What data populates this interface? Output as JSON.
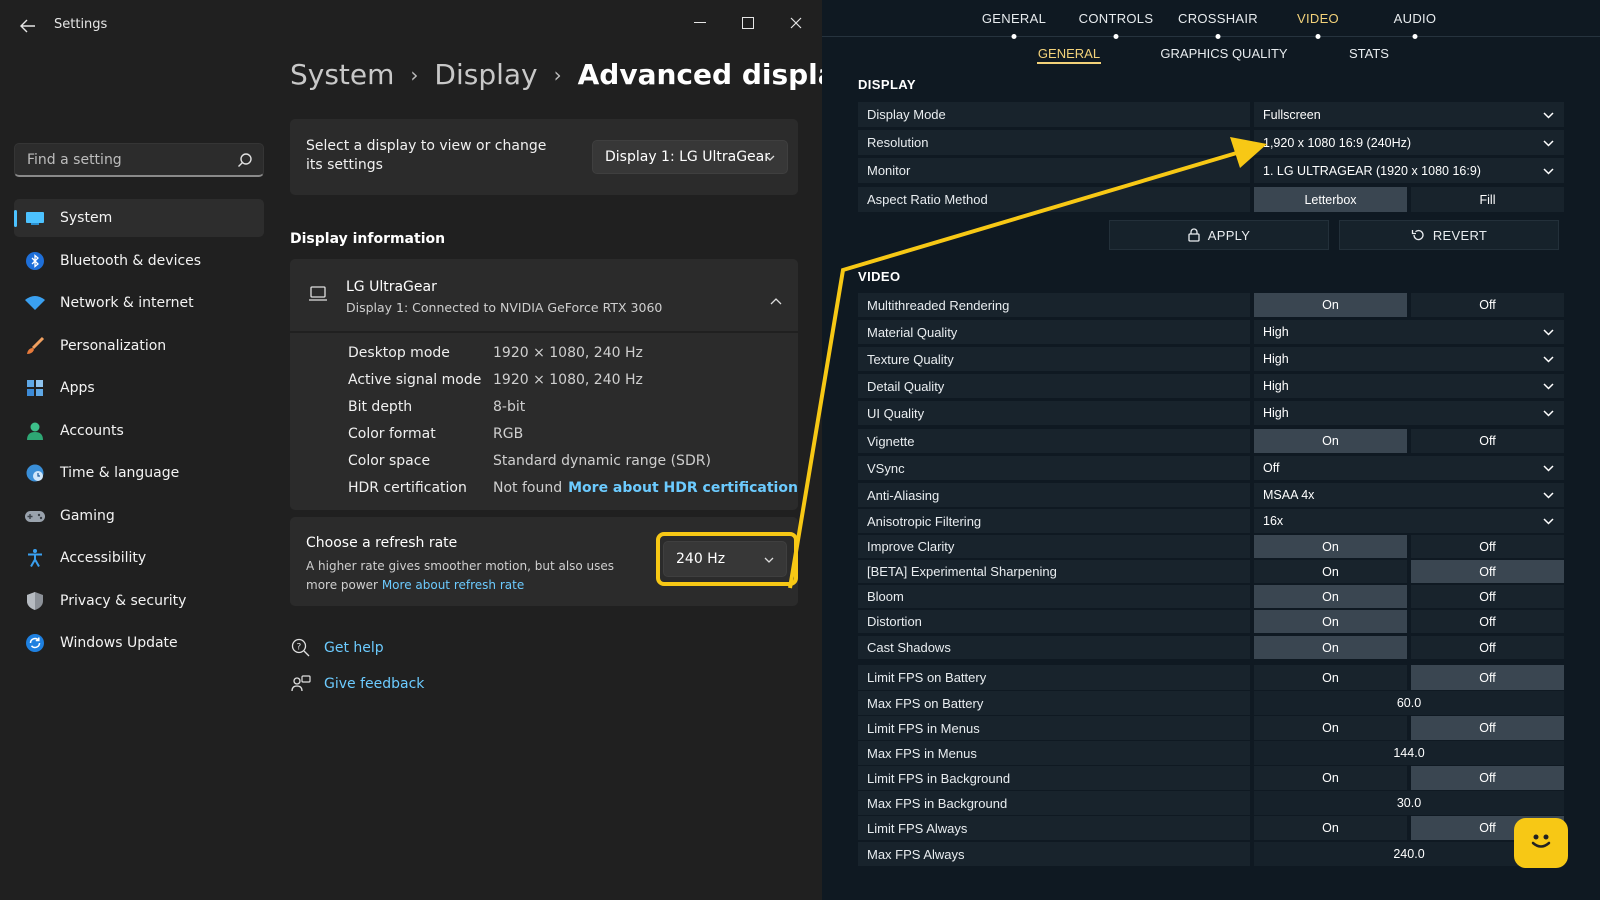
{
  "settings": {
    "app_title": "Settings",
    "search": {
      "placeholder": "Find a setting"
    },
    "nav": [
      {
        "label": "System",
        "icon": "monitor-icon",
        "active": true
      },
      {
        "label": "Bluetooth & devices",
        "icon": "bluetooth-icon"
      },
      {
        "label": "Network & internet",
        "icon": "wifi-icon"
      },
      {
        "label": "Personalization",
        "icon": "paintbrush-icon"
      },
      {
        "label": "Apps",
        "icon": "apps-icon"
      },
      {
        "label": "Accounts",
        "icon": "person-icon"
      },
      {
        "label": "Time & language",
        "icon": "globe-clock-icon"
      },
      {
        "label": "Gaming",
        "icon": "gamepad-icon"
      },
      {
        "label": "Accessibility",
        "icon": "accessibility-icon"
      },
      {
        "label": "Privacy & security",
        "icon": "shield-icon"
      },
      {
        "label": "Windows Update",
        "icon": "update-icon"
      }
    ],
    "breadcrumb": [
      "System",
      "Display",
      "Advanced display"
    ],
    "select_display": {
      "text": "Select a display to view or change its settings",
      "value": "Display 1: LG UltraGear"
    },
    "display_info": {
      "title": "Display information",
      "monitor_name": "LG UltraGear",
      "monitor_sub": "Display 1: Connected to NVIDIA GeForce RTX 3060",
      "rows": [
        {
          "label": "Desktop mode",
          "value": "1920 × 1080, 240 Hz"
        },
        {
          "label": "Active signal mode",
          "value": "1920 × 1080, 240 Hz"
        },
        {
          "label": "Bit depth",
          "value": "8-bit"
        },
        {
          "label": "Color format",
          "value": "RGB"
        },
        {
          "label": "Color space",
          "value": "Standard dynamic range (SDR)"
        },
        {
          "label": "HDR certification",
          "value": "Not found",
          "link": "More about HDR certification"
        }
      ]
    },
    "refresh": {
      "title": "Choose a refresh rate",
      "desc": "A higher rate gives smoother motion, but also uses more power",
      "link": "More about refresh rate",
      "value": "240 Hz"
    },
    "help": {
      "get_help": "Get help",
      "feedback": "Give feedback"
    }
  },
  "game": {
    "tabs": [
      "GENERAL",
      "CONTROLS",
      "CROSSHAIR",
      "VIDEO",
      "AUDIO"
    ],
    "active_tab": "VIDEO",
    "subtabs": [
      "GENERAL",
      "GRAPHICS QUALITY",
      "STATS"
    ],
    "active_subtab": "GENERAL",
    "display_section": "DISPLAY",
    "display_rows": [
      {
        "label": "Display Mode",
        "value": "Fullscreen"
      },
      {
        "label": "Resolution",
        "value": "1,920 x 1080 16:9 (240Hz)"
      },
      {
        "label": "Monitor",
        "value": "1. LG ULTRAGEAR (1920 x 1080 16:9)"
      }
    ],
    "aspect": {
      "label": "Aspect Ratio Method",
      "opt1": "Letterbox",
      "opt2": "Fill",
      "selected": "Letterbox"
    },
    "apply_label": "APPLY",
    "revert_label": "REVERT",
    "video_section": "VIDEO",
    "video_rows": [
      {
        "label": "Multithreaded Rendering",
        "type": "toggle",
        "selected": "On"
      },
      {
        "label": "Material Quality",
        "type": "dropdown",
        "value": "High"
      },
      {
        "label": "Texture Quality",
        "type": "dropdown",
        "value": "High"
      },
      {
        "label": "Detail Quality",
        "type": "dropdown",
        "value": "High"
      },
      {
        "label": "UI Quality",
        "type": "dropdown",
        "value": "High"
      },
      {
        "label": "Vignette",
        "type": "toggle",
        "selected": "On"
      },
      {
        "label": "VSync",
        "type": "dropdown",
        "value": "Off"
      },
      {
        "label": "Anti-Aliasing",
        "type": "dropdown",
        "value": "MSAA 4x"
      },
      {
        "label": "Anisotropic Filtering",
        "type": "dropdown",
        "value": "16x"
      },
      {
        "label": "Improve Clarity",
        "type": "toggle",
        "selected": "On"
      },
      {
        "label": "[BETA] Experimental Sharpening",
        "type": "toggle",
        "selected": "Off"
      },
      {
        "label": "Bloom",
        "type": "toggle",
        "selected": "On"
      },
      {
        "label": "Distortion",
        "type": "toggle",
        "selected": "On"
      },
      {
        "label": "Cast Shadows",
        "type": "toggle",
        "selected": "On"
      },
      {
        "label": "Limit FPS on Battery",
        "type": "toggle",
        "selected": "Off"
      },
      {
        "label": "Max FPS on Battery",
        "type": "number",
        "value": "60.0"
      },
      {
        "label": "Limit FPS in Menus",
        "type": "toggle",
        "selected": "Off"
      },
      {
        "label": "Max FPS in Menus",
        "type": "number",
        "value": "144.0"
      },
      {
        "label": "Limit FPS in Background",
        "type": "toggle",
        "selected": "Off"
      },
      {
        "label": "Max FPS in Background",
        "type": "number",
        "value": "30.0"
      },
      {
        "label": "Limit FPS Always",
        "type": "toggle",
        "selected": "Off"
      },
      {
        "label": "Max FPS Always",
        "type": "number",
        "value": "240.0"
      }
    ],
    "toggle_on": "On",
    "toggle_off": "Off"
  },
  "colors": {
    "accent_blue": "#4cc2ff",
    "link_blue": "#6ccbff",
    "highlight_yellow": "#f7c815",
    "game_bg": "#0f1922",
    "game_gold": "#f3d27a"
  }
}
